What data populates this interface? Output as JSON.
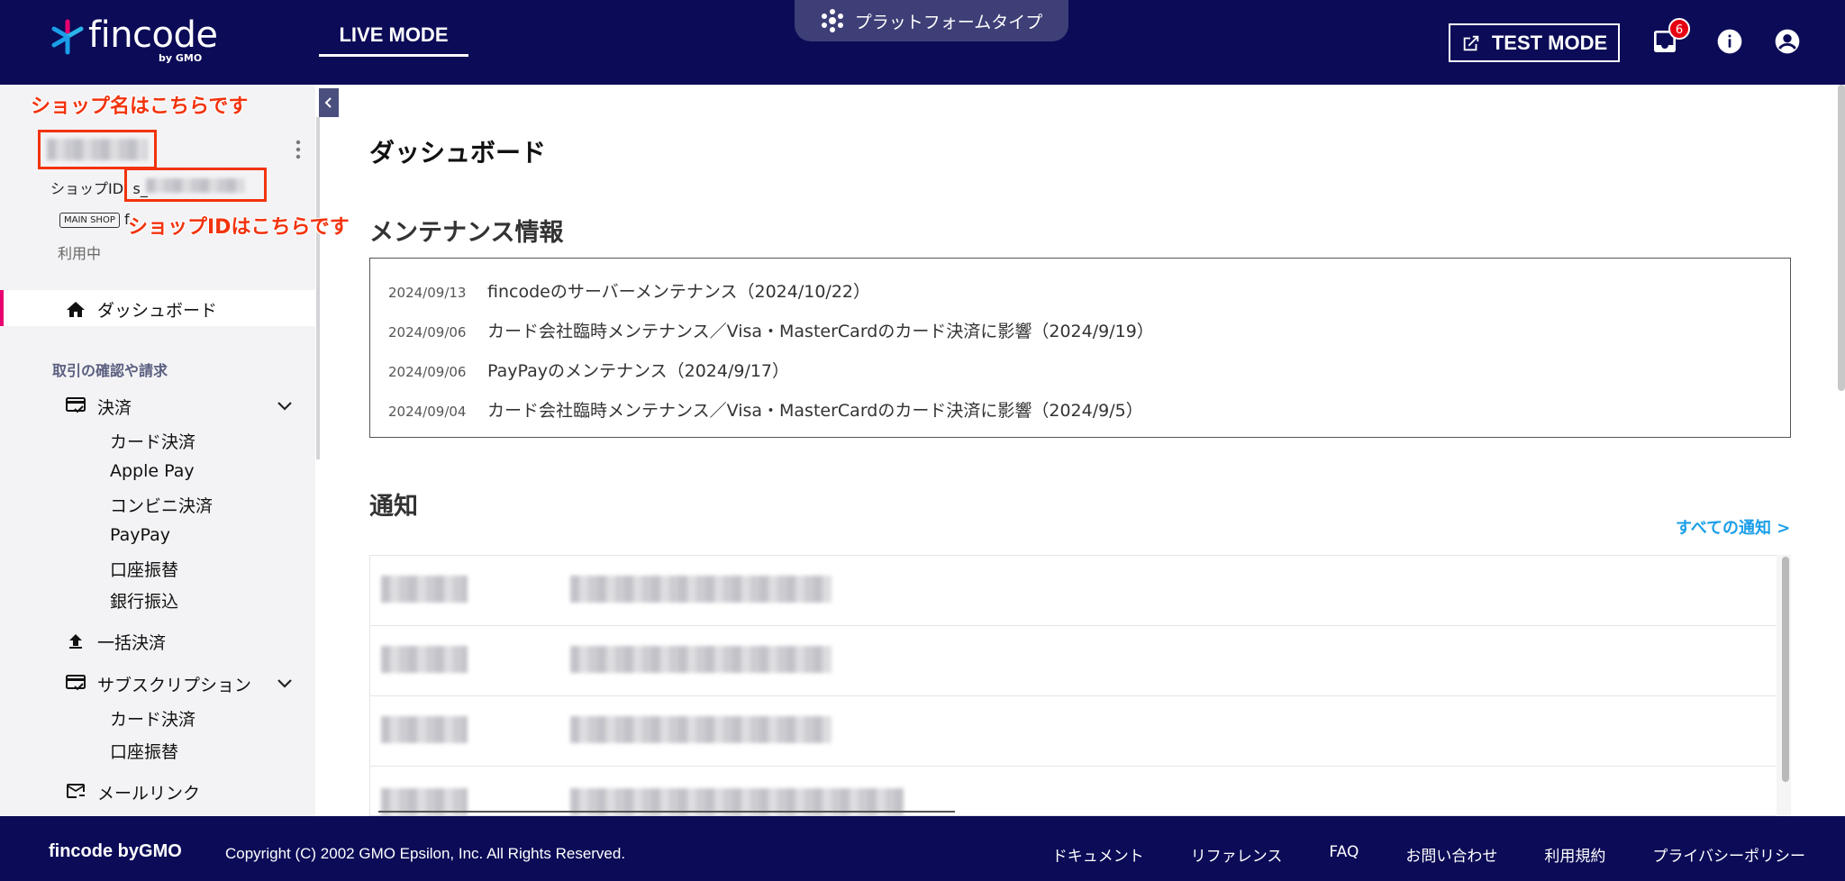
{
  "header": {
    "logo_text": "fincode",
    "logo_sub": "by GMO",
    "mode_tab": "LIVE MODE",
    "platform_type": "プラットフォームタイプ",
    "test_mode": "TEST MODE",
    "notification_count": "6",
    "icons": [
      "inbox-icon",
      "info-icon",
      "account-icon",
      "external-link-icon",
      "platform-icon"
    ]
  },
  "annotations": {
    "shop_name": "ショップ名はこちらです",
    "shop_id": "ショップIDはこちらです"
  },
  "shop": {
    "id_label": "ショップID: s_",
    "main_shop_tag": "MAIN SHOP",
    "prefix": "f",
    "status": "利用中"
  },
  "sidebar": {
    "dashboard": "ダッシュボード",
    "section_transactions": "取引の確認や請求",
    "payments": "決済",
    "payments_sub": [
      "カード決済",
      "Apple Pay",
      "コンビニ決済",
      "PayPay",
      "口座振替",
      "銀行振込"
    ],
    "bulk_payment": "一括決済",
    "subscription": "サブスクリプション",
    "subscription_sub": [
      "カード決済",
      "口座振替"
    ],
    "mail_link": "メールリンク"
  },
  "main": {
    "page_title": "ダッシュボード",
    "maintenance_title": "メンテナンス情報",
    "maintenance": [
      {
        "date": "2024/09/13",
        "text": "fincodeのサーバーメンテナンス（2024/10/22）"
      },
      {
        "date": "2024/09/06",
        "text": "カード会社臨時メンテナンス／Visa・MasterCardのカード決済に影響（2024/9/19）"
      },
      {
        "date": "2024/09/06",
        "text": "PayPayのメンテナンス（2024/9/17）"
      },
      {
        "date": "2024/09/04",
        "text": "カード会社臨時メンテナンス／Visa・MasterCardのカード決済に影響（2024/9/5）"
      }
    ],
    "notifications_title": "通知",
    "all_notifications": "すべての通知 >"
  },
  "footer": {
    "brand": "fincode byGMO",
    "copyright": "Copyright (C) 2002 GMO Epsilon, Inc. All Rights Reserved.",
    "links": [
      "ドキュメント",
      "リファレンス",
      "FAQ",
      "お問い合わせ",
      "利用規約",
      "プライバシーポリシー"
    ]
  },
  "colors": {
    "header_bg": "#0b0b57",
    "accent_link": "#1a9ee8",
    "annotation_red": "#f2330d",
    "active_bar": "#e8006f"
  }
}
